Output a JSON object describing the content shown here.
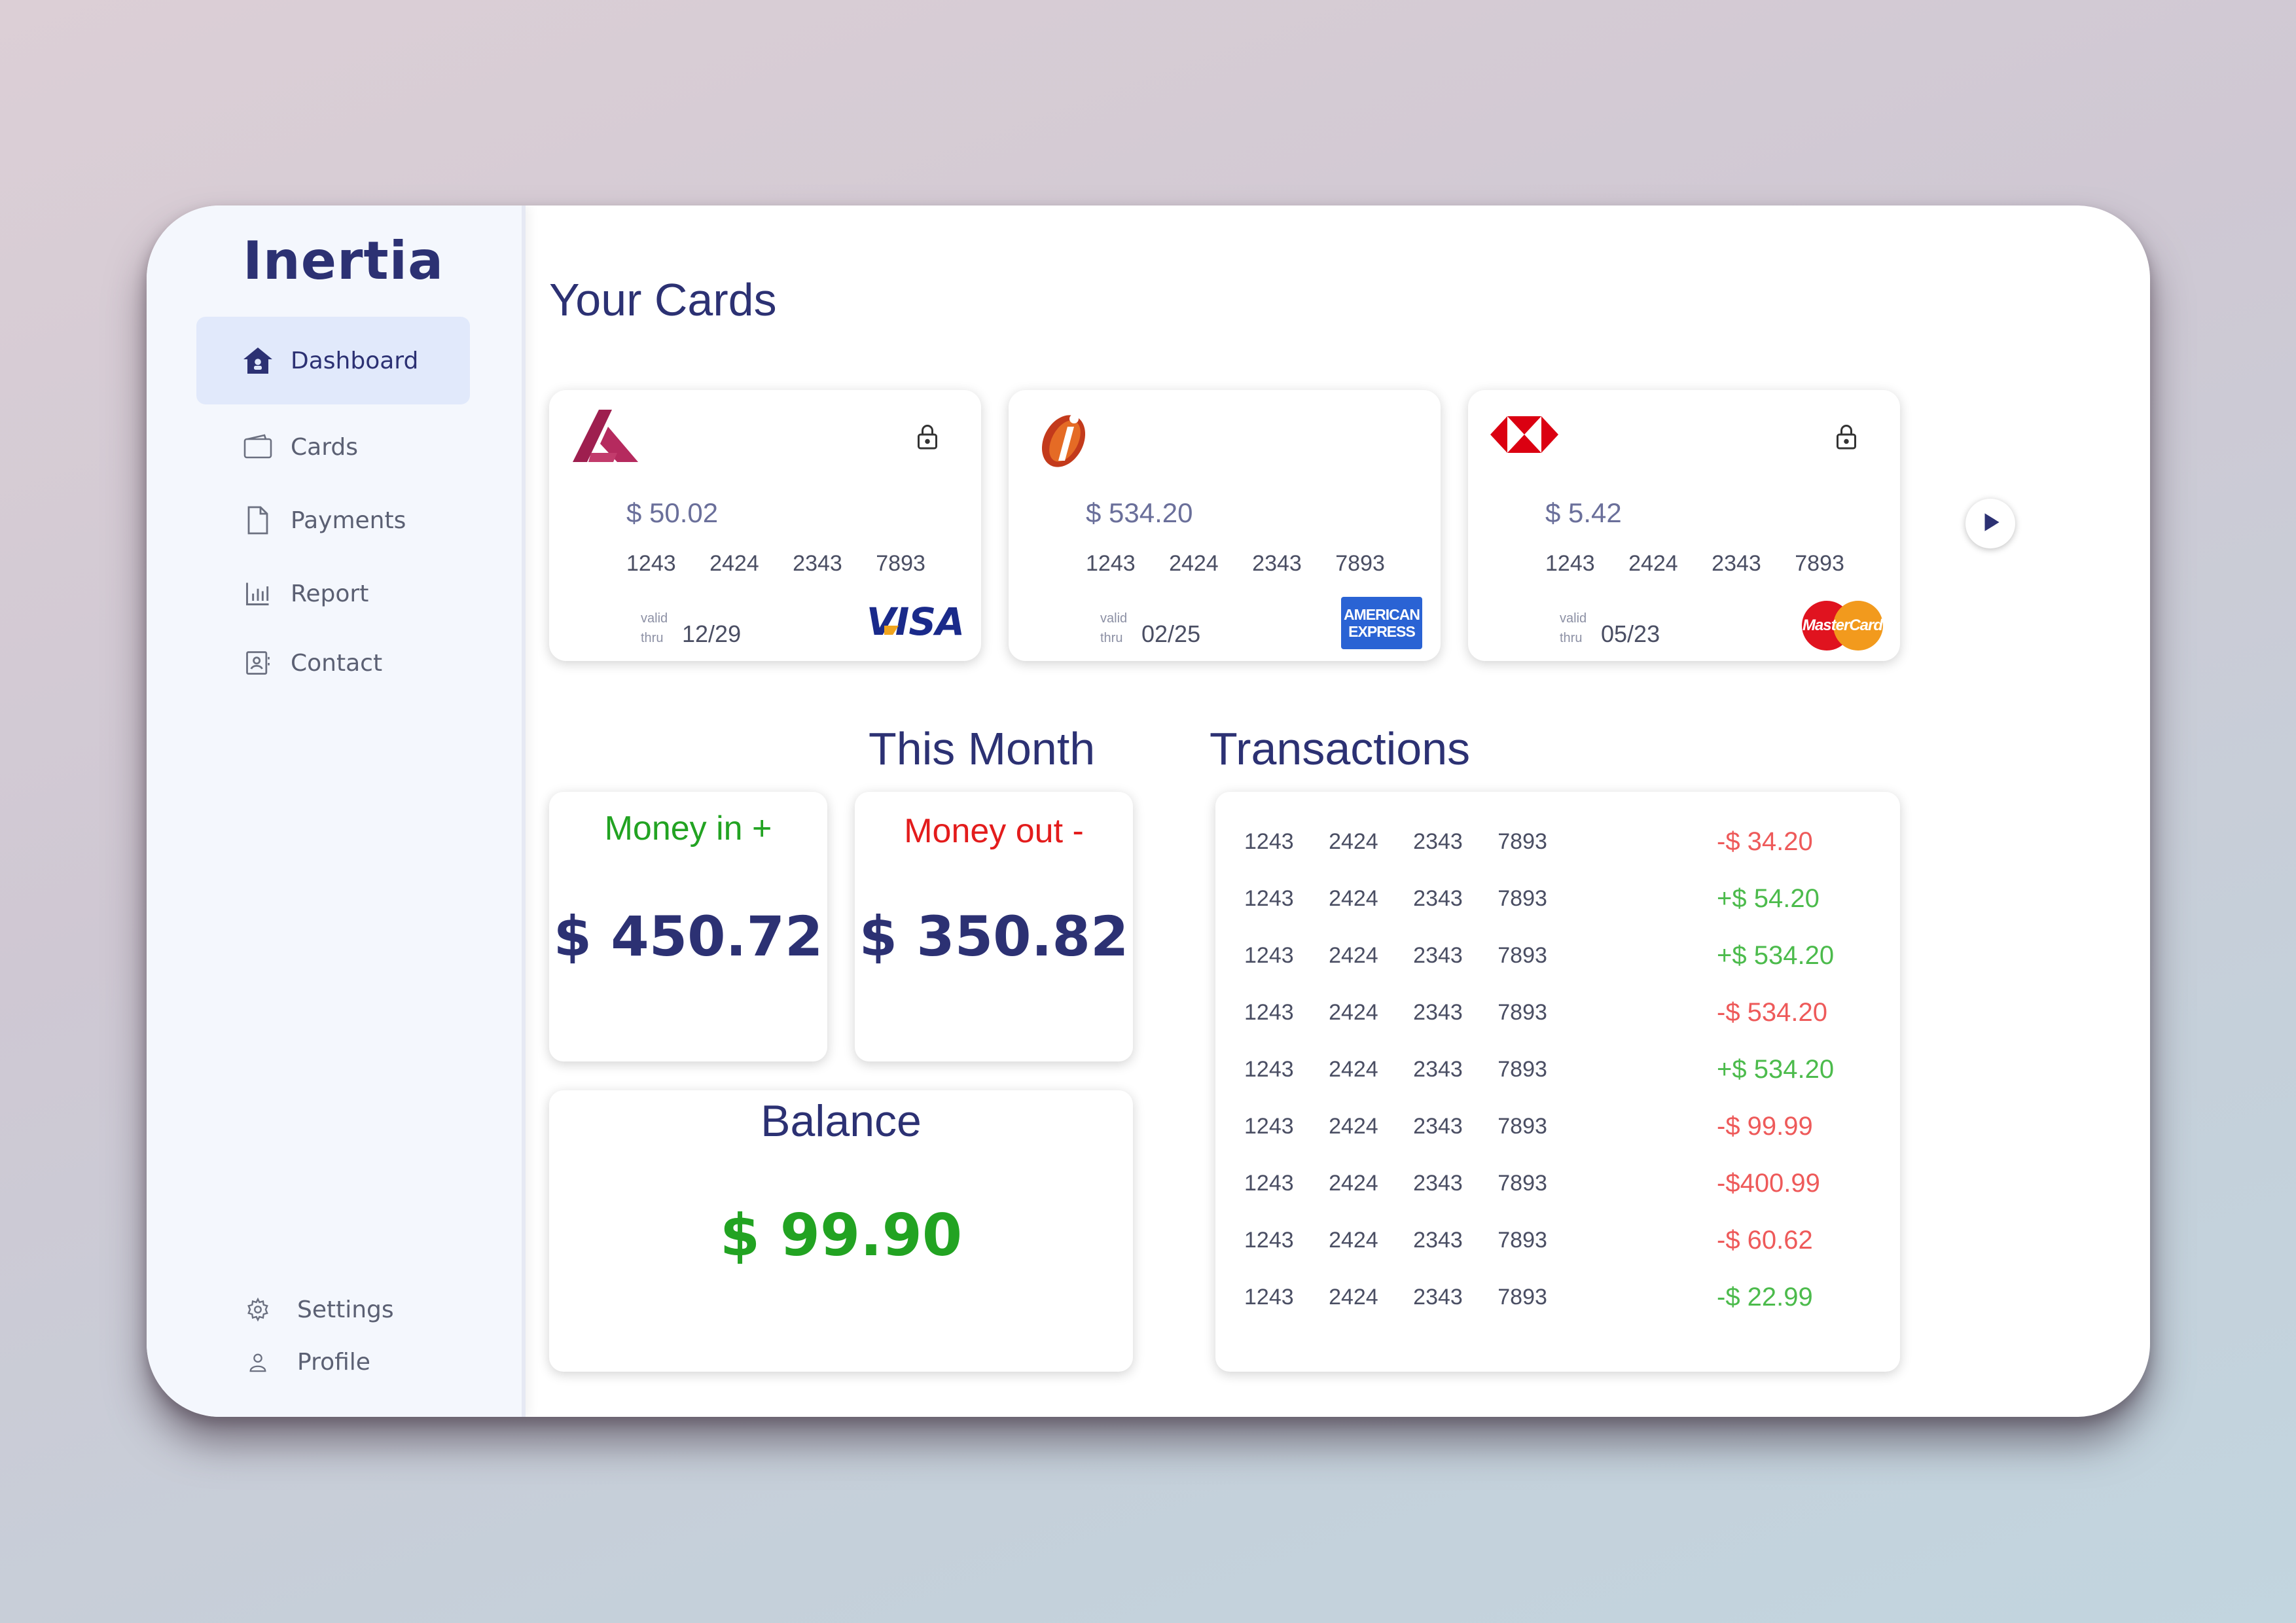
{
  "app": {
    "brand": "Inertia"
  },
  "sidebar": {
    "items": [
      {
        "label": "Dashboard",
        "icon": "home-icon",
        "active": true
      },
      {
        "label": "Cards",
        "icon": "wallet-icon"
      },
      {
        "label": "Payments",
        "icon": "document-icon"
      },
      {
        "label": "Report",
        "icon": "bar-chart-icon"
      },
      {
        "label": "Contact",
        "icon": "contact-card-icon"
      }
    ],
    "bottom": [
      {
        "label": "Settings",
        "icon": "gear-icon"
      },
      {
        "label": "Profile",
        "icon": "user-icon"
      }
    ]
  },
  "main": {
    "cards_title": "Your Cards",
    "cards": [
      {
        "bank": "axis-logo",
        "amount": "$ 50.02",
        "number": "1243 2424 2343 7893",
        "valid_label_1": "valid",
        "valid_label_2": "thru",
        "expiry": "12/29",
        "network": "VISA",
        "locked": true
      },
      {
        "bank": "icici-logo",
        "amount": "$ 534.20",
        "number": "1243 2424 2343 7893",
        "valid_label_1": "valid",
        "valid_label_2": "thru",
        "expiry": "02/25",
        "network_line_1": "AMERICAN",
        "network_line_2": "EXPRESS",
        "locked": false
      },
      {
        "bank": "hsbc-logo",
        "amount": "$ 5.42",
        "number": "1243 2424 2343 7893",
        "valid_label_1": "valid",
        "valid_label_2": "thru",
        "expiry": "05/23",
        "network": "MasterCard",
        "locked": true
      }
    ],
    "this_month_title": "This Month",
    "money_in": {
      "label": "Money in +",
      "amount": "$ 450.72"
    },
    "money_out": {
      "label": "Money out -",
      "amount": "$ 350.82"
    },
    "balance": {
      "label": "Balance",
      "amount": "$ 99.90"
    },
    "transactions_title": "Transactions",
    "transactions": [
      {
        "number": "1243 2424 2343 7893",
        "amount": "-$ 34.20",
        "type": "out"
      },
      {
        "number": "1243 2424 2343 7893",
        "amount": "+$ 54.20",
        "type": "in"
      },
      {
        "number": "1243 2424 2343 7893",
        "amount": "+$ 534.20",
        "type": "in"
      },
      {
        "number": "1243 2424 2343 7893",
        "amount": "-$ 534.20",
        "type": "out"
      },
      {
        "number": "1243 2424 2343 7893",
        "amount": "+$ 534.20",
        "type": "in"
      },
      {
        "number": "1243 2424 2343 7893",
        "amount": "-$ 99.99",
        "type": "out"
      },
      {
        "number": "1243 2424 2343 7893",
        "amount": "-$400.99",
        "type": "out"
      },
      {
        "number": "1243 2424 2343 7893",
        "amount": "-$ 60.62",
        "type": "out"
      },
      {
        "number": "1243 2424 2343 7893",
        "amount": "-$ 22.99",
        "type": "in"
      }
    ]
  },
  "colors": {
    "primary": "#2c3173",
    "green": "#22a322",
    "red": "#e31c1c",
    "tx_red": "#ee5a5a",
    "tx_green": "#4cbb4c"
  }
}
